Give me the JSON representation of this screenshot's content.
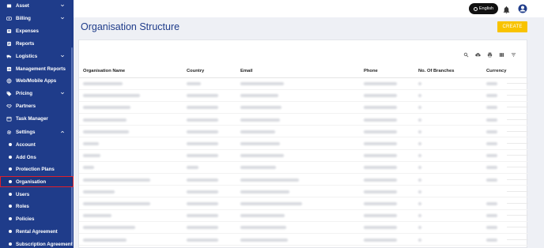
{
  "sidebar": {
    "items": [
      {
        "label": "Asset",
        "name": "sidebar-item-asset",
        "icon": "asset-icon",
        "chevron": true,
        "sub": false,
        "active": false
      },
      {
        "label": "Billing",
        "name": "sidebar-item-billing",
        "icon": "billing-icon",
        "chevron": true,
        "sub": false,
        "active": false
      },
      {
        "label": "Expenses",
        "name": "sidebar-item-expenses",
        "icon": "expenses-icon",
        "chevron": false,
        "sub": false,
        "active": false
      },
      {
        "label": "Reports",
        "name": "sidebar-item-reports",
        "icon": "reports-icon",
        "chevron": false,
        "sub": false,
        "active": false
      },
      {
        "label": "Logistics",
        "name": "sidebar-item-logistics",
        "icon": "truck-icon",
        "chevron": true,
        "sub": false,
        "active": false
      },
      {
        "label": "Management Reports",
        "name": "sidebar-item-management-reports",
        "icon": "chart-icon",
        "chevron": false,
        "sub": false,
        "active": false
      },
      {
        "label": "Web/Mobile Apps",
        "name": "sidebar-item-web-mobile-apps",
        "icon": "globe-icon",
        "chevron": false,
        "sub": false,
        "active": false
      },
      {
        "label": "Pricing",
        "name": "sidebar-item-pricing",
        "icon": "tag-icon",
        "chevron": true,
        "sub": false,
        "active": false
      },
      {
        "label": "Partners",
        "name": "sidebar-item-partners",
        "icon": "handshake-icon",
        "chevron": false,
        "sub": false,
        "active": false
      },
      {
        "label": "Task Manager",
        "name": "sidebar-item-task-manager",
        "icon": "calendar-icon",
        "chevron": false,
        "sub": false,
        "active": false
      },
      {
        "label": "Settings",
        "name": "sidebar-item-settings",
        "icon": "gear-icon",
        "chevron": true,
        "sub": false,
        "active": false,
        "expanded": true
      },
      {
        "label": "Account",
        "name": "sidebar-item-account",
        "sub": true,
        "active": false
      },
      {
        "label": "Add Ons",
        "name": "sidebar-item-add-ons",
        "sub": true,
        "active": false
      },
      {
        "label": "Protection Plans",
        "name": "sidebar-item-protection-plans",
        "sub": true,
        "active": false
      },
      {
        "label": "Organisation",
        "name": "sidebar-item-organisation",
        "sub": true,
        "active": true
      },
      {
        "label": "Users",
        "name": "sidebar-item-users",
        "sub": true,
        "active": false
      },
      {
        "label": "Roles",
        "name": "sidebar-item-roles",
        "sub": true,
        "active": false
      },
      {
        "label": "Policies",
        "name": "sidebar-item-policies",
        "sub": true,
        "active": false
      },
      {
        "label": "Rental Agreement",
        "name": "sidebar-item-rental-agreement",
        "sub": true,
        "active": false
      },
      {
        "label": "Subscription Agreement",
        "name": "sidebar-item-subscription-agreement",
        "sub": true,
        "active": false
      }
    ]
  },
  "topbar": {
    "language_label": "English",
    "bell_icon": "bell-icon",
    "user_icon": "user-circle-icon"
  },
  "page": {
    "title": "Organisation Structure",
    "create_label": "CREATE"
  },
  "toolbar_icons": [
    "search-icon",
    "cloud-download-icon",
    "print-icon",
    "columns-icon",
    "filter-icon"
  ],
  "table": {
    "columns": [
      "Organisation Name",
      "Country",
      "Email",
      "Phone",
      "No. Of Branches",
      "Currency"
    ],
    "row_count": 14
  },
  "colors": {
    "sidebar_bg": "#1f3c8a",
    "accent": "#f8c300",
    "title": "#1f3c8a",
    "active_outline": "#e0202a"
  }
}
